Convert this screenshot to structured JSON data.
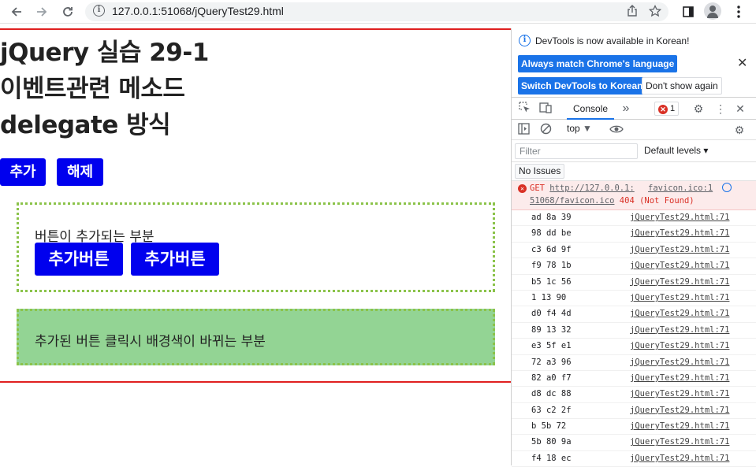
{
  "browser": {
    "url": "127.0.0.1:51068/jQueryTest29.html",
    "back_icon": "arrow-left-icon",
    "forward_icon": "arrow-right-icon",
    "reload_icon": "reload-icon"
  },
  "page": {
    "title_line1": "jQuery 실습 29-1",
    "title_line2": "이벤트관련 메소드",
    "title_line3": "delegate 방식",
    "add_button": "추가",
    "remove_button": "해제",
    "box1_label": "버튼이 추가되는 부분",
    "added_buttons": [
      "추가버튼",
      "추가버튼"
    ],
    "box2_label": "추가된 버튼 클릭시 배경색이 바뀌는 부분",
    "colors": {
      "accent_blue": "#0000ee",
      "box_border": "#8bc34a",
      "box2_bg": "#93d494",
      "divider_red": "#e02020"
    }
  },
  "devtools": {
    "info_text": "DevTools is now available in Korean!",
    "match_language_button": "Always match Chrome's language",
    "switch_korean_button": "Switch DevTools to Korean",
    "dont_show_button": "Don't show again",
    "console_tab": "Console",
    "more_tabs": "»",
    "error_count": "1",
    "context": "top",
    "filter_placeholder": "Filter",
    "default_levels": "Default levels",
    "no_issues": "No Issues",
    "error": {
      "method": "GET",
      "url_part1": "http://127.0.0.1:",
      "url_part2": "51068/favicon.ico",
      "status": "404 (Not Found)",
      "source": "favicon.ico:1"
    },
    "logs": [
      {
        "msg": "ad 8a 39",
        "src": "jQueryTest29.html:71"
      },
      {
        "msg": "98 dd be",
        "src": "jQueryTest29.html:71"
      },
      {
        "msg": "c3 6d 9f",
        "src": "jQueryTest29.html:71"
      },
      {
        "msg": "f9 78 1b",
        "src": "jQueryTest29.html:71"
      },
      {
        "msg": "b5 1c 56",
        "src": "jQueryTest29.html:71"
      },
      {
        "msg": "1 13 90",
        "src": "jQueryTest29.html:71"
      },
      {
        "msg": "d0 f4 4d",
        "src": "jQueryTest29.html:71"
      },
      {
        "msg": "89 13 32",
        "src": "jQueryTest29.html:71"
      },
      {
        "msg": "e3 5f e1",
        "src": "jQueryTest29.html:71"
      },
      {
        "msg": "72 a3 96",
        "src": "jQueryTest29.html:71"
      },
      {
        "msg": "82 a0 f7",
        "src": "jQueryTest29.html:71"
      },
      {
        "msg": "d8 dc 88",
        "src": "jQueryTest29.html:71"
      },
      {
        "msg": "63 c2 2f",
        "src": "jQueryTest29.html:71"
      },
      {
        "msg": "b 5b 72",
        "src": "jQueryTest29.html:71"
      },
      {
        "msg": "5b 80 9a",
        "src": "jQueryTest29.html:71"
      },
      {
        "msg": "f4 18 ec",
        "src": "jQueryTest29.html:71"
      }
    ]
  }
}
